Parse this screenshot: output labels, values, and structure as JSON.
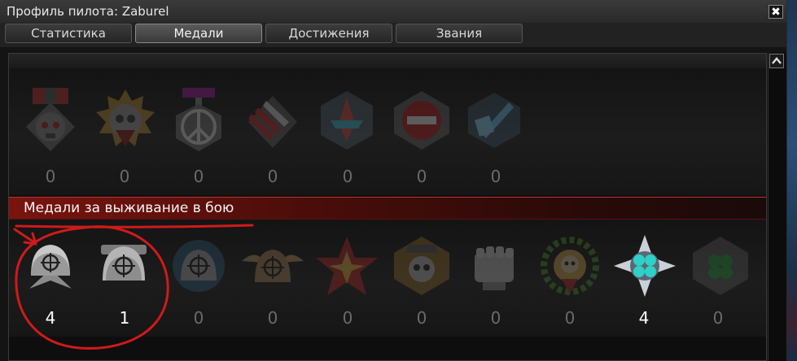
{
  "window": {
    "title": "Профиль пилота: Zaburel",
    "close_glyph": "✖"
  },
  "tabs": [
    {
      "label": "Статистика",
      "active": false
    },
    {
      "label": "Медали",
      "active": true
    },
    {
      "label": "Достижения",
      "active": false
    },
    {
      "label": "Звания",
      "active": false
    }
  ],
  "scrollbar": {
    "up_icon": "chevron-up-icon"
  },
  "group1": {
    "medals": [
      {
        "icon": "skull-banner-medal-icon",
        "count": "0"
      },
      {
        "icon": "golden-skull-medal-icon",
        "count": "0"
      },
      {
        "icon": "peace-sign-medal-icon",
        "count": "0"
      },
      {
        "icon": "missile-medal-icon",
        "count": "0"
      },
      {
        "icon": "ship-medal-icon",
        "count": "0"
      },
      {
        "icon": "no-entry-medal-icon",
        "count": "0"
      },
      {
        "icon": "blue-blade-medal-icon",
        "count": "0"
      }
    ]
  },
  "group2": {
    "title": "Медали за выживание в бою",
    "medals": [
      {
        "icon": "target-helmet-medal-icon",
        "count": "4",
        "earned": true
      },
      {
        "icon": "target-helmet-2-medal-icon",
        "count": "1",
        "earned": true
      },
      {
        "icon": "target-helmet-3-medal-icon",
        "count": "0",
        "earned": false
      },
      {
        "icon": "winged-target-medal-icon",
        "count": "0",
        "earned": false
      },
      {
        "icon": "red-star-medal-icon",
        "count": "0",
        "earned": false
      },
      {
        "icon": "skull-cap-medal-icon",
        "count": "0",
        "earned": false
      },
      {
        "icon": "fist-medal-icon",
        "count": "0",
        "earned": false
      },
      {
        "icon": "laurel-skull-medal-icon",
        "count": "0",
        "earned": false
      },
      {
        "icon": "cyan-clover-medal-icon",
        "count": "4",
        "earned": true
      },
      {
        "icon": "green-clover-medal-icon",
        "count": "0",
        "earned": false
      }
    ]
  },
  "colors": {
    "accent_red": "#c61a1a",
    "header_red": "#7a140e",
    "text": "#f4f4f4",
    "dim_text": "#6a6a6a"
  }
}
